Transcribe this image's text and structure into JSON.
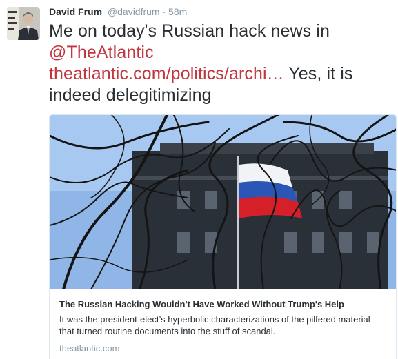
{
  "author": {
    "name": "David Frum",
    "handle": "@davidfrum",
    "separator": "·",
    "time": "58m"
  },
  "tweet": {
    "text_before": "Me on today's Russian hack news in ",
    "mention": "@TheAtlantic",
    "link": "theatlantic.com/politics/archi…",
    "text_after": " Yes, it is indeed delegitimizing"
  },
  "card": {
    "title": "The Russian Hacking Wouldn't Have Worked Without Trump's Help",
    "description": "It was the president-elect’s hyperbolic characterizations of the pilfered material that turned routine documents into the stuff of scandal.",
    "domain": "theatlantic.com"
  },
  "colors": {
    "link": "#c2363f",
    "text": "#292f33",
    "muted": "#8899a6",
    "border": "#e1e8ed"
  }
}
